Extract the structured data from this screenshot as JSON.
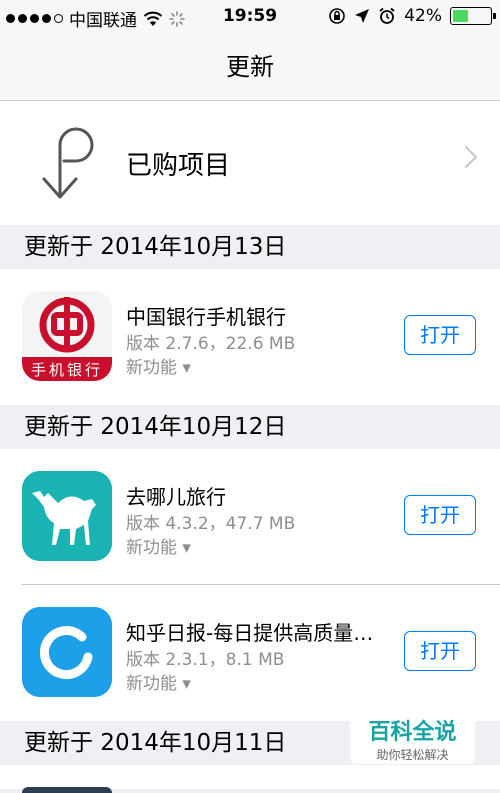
{
  "status": {
    "carrier": "中国联通",
    "time": "19:59",
    "battery": "42%",
    "battery_level": 0.42,
    "battery_color": "#4cd964"
  },
  "nav": {
    "title": "更新"
  },
  "purchased": {
    "label": "已购项目",
    "icon": "purchased-arrow-icon"
  },
  "sections": [
    {
      "date": "更新于 2014年10月13日"
    },
    {
      "date": "更新于 2014年10月12日"
    },
    {
      "date": "更新于 2014年10月11日"
    }
  ],
  "apps": [
    {
      "name": "中国银行手机银行",
      "version": "版本 2.7.6，22.6 MB",
      "whats_new": "新功能 ▾",
      "button": "打开",
      "icon_text": "手机银行",
      "icon_color": "#c8102e"
    },
    {
      "name": "去哪儿旅行",
      "version": "版本 4.3.2，47.7 MB",
      "whats_new": "新功能 ▾",
      "button": "打开",
      "icon_color": "#1ab3b3"
    },
    {
      "name": "知乎日报-每日提供高质量…",
      "version": "版本 2.3.1，8.1 MB",
      "whats_new": "新功能 ▾",
      "button": "打开",
      "icon_color": "#1ea0e8"
    }
  ],
  "watermark": {
    "title": "百科全说",
    "subtitle": "助你轻松解决"
  },
  "accent_color": "#007aff"
}
